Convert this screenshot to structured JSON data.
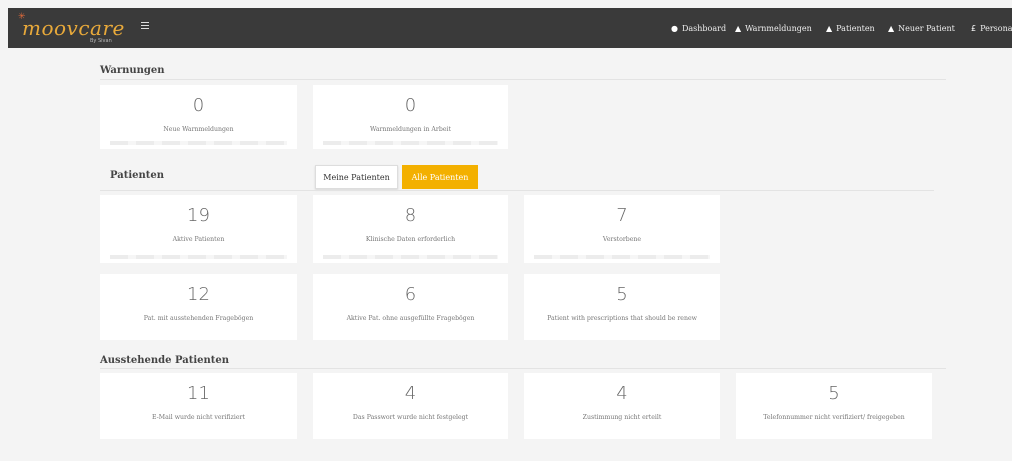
{
  "brand": {
    "logo": "moovcare",
    "sub": "By Sivan"
  },
  "nav": {
    "dashboard": "Dashboard",
    "warnings": "Warnmeldungen",
    "patients": "Patienten",
    "new_patient": "Neuer Patient",
    "personal": "Personal"
  },
  "warnings": {
    "title": "Warnungen",
    "cards": [
      {
        "value": "0",
        "label": "Neue Warnmeldungen"
      },
      {
        "value": "0",
        "label": "Warnmeldungen in Arbeit"
      }
    ]
  },
  "patients": {
    "title": "Patienten",
    "toggle": {
      "mine": "Meine Patienten",
      "all": "Alle Patienten"
    },
    "cards": [
      {
        "value": "19",
        "label": "Aktive Patienten"
      },
      {
        "value": "8",
        "label": "Klinische Daten erforderlich"
      },
      {
        "value": "7",
        "label": "Verstorbene"
      },
      {
        "value": "12",
        "label": "Pat. mit ausstehenden Fragebögen"
      },
      {
        "value": "6",
        "label": "Aktive Pat. ohne ausgefüllte Fragebögen"
      },
      {
        "value": "5",
        "label": "Patient with prescriptions that should be renew"
      }
    ]
  },
  "pending": {
    "title": "Ausstehende Patienten",
    "cards": [
      {
        "value": "11",
        "label": "E-Mail wurde nicht verifiziert"
      },
      {
        "value": "4",
        "label": "Das Passwort wurde nicht festgelegt"
      },
      {
        "value": "4",
        "label": "Zustimmung nicht erteilt"
      },
      {
        "value": "5",
        "label": "Telefonnummer nicht verifiziert/ freigegeben"
      }
    ]
  },
  "colors": {
    "topbar": "#3a3a3a",
    "accent": "#f3b000",
    "logo": "#e8a93a"
  }
}
